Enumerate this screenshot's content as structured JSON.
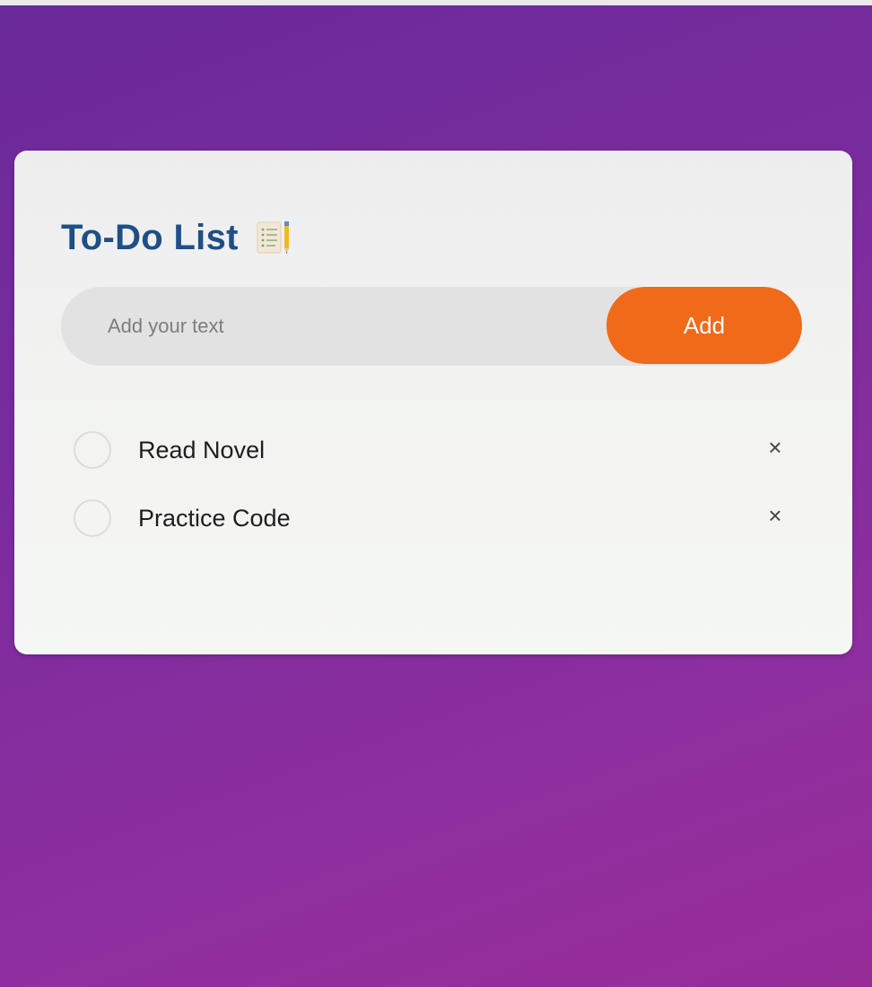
{
  "app": {
    "title": "To-Do List",
    "title_icon": "notepad-pencil-icon"
  },
  "input": {
    "value": "",
    "placeholder": "Add your text"
  },
  "add_button": {
    "label": "Add"
  },
  "tasks": [
    {
      "text": "Read Novel",
      "checked": false,
      "remove_label": "×"
    },
    {
      "text": "Practice Code",
      "checked": false,
      "remove_label": "×"
    }
  ],
  "colors": {
    "accent": "#f06a1a",
    "title": "#1f4f86",
    "background_top": "#6a2a9a",
    "background_bottom": "#972c98",
    "card": "#f2f3f1"
  }
}
